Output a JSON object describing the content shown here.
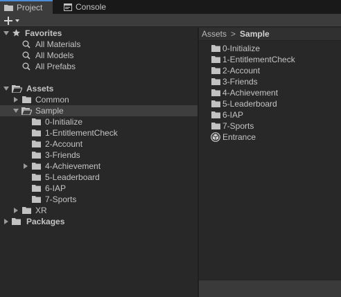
{
  "tabs": [
    {
      "label": "Project",
      "icon": "folder-icon",
      "active": true
    },
    {
      "label": "Console",
      "icon": "console-icon",
      "active": false
    }
  ],
  "toolbar": {
    "add_label": "+",
    "add_icon": "plus-dropdown-icon"
  },
  "tree": {
    "favorites": {
      "label": "Favorites",
      "items": [
        "All Materials",
        "All Models",
        "All Prefabs"
      ]
    },
    "assets": {
      "label": "Assets",
      "common": "Common",
      "sample": "Sample",
      "sample_children": [
        "0-Initialize",
        "1-EntitlementCheck",
        "2-Account",
        "3-Friends",
        "4-Achievement",
        "5-Leaderboard",
        "6-IAP",
        "7-Sports"
      ],
      "xr": "XR"
    },
    "packages": "Packages"
  },
  "breadcrumb": {
    "root": "Assets",
    "separator": ">",
    "current": "Sample"
  },
  "contents": [
    {
      "label": "0-Initialize",
      "icon": "folder-icon"
    },
    {
      "label": "1-EntitlementCheck",
      "icon": "folder-icon"
    },
    {
      "label": "2-Account",
      "icon": "folder-icon"
    },
    {
      "label": "3-Friends",
      "icon": "folder-icon"
    },
    {
      "label": "4-Achievement",
      "icon": "folder-icon"
    },
    {
      "label": "5-Leaderboard",
      "icon": "folder-icon"
    },
    {
      "label": "6-IAP",
      "icon": "folder-icon"
    },
    {
      "label": "7-Sports",
      "icon": "folder-icon"
    },
    {
      "label": "Entrance",
      "icon": "unity-scene-icon"
    }
  ],
  "colors": {
    "background": "#282828",
    "tab_accent": "#4d8cd6",
    "selection": "#3e3e3e",
    "folder": "#c2c2c2"
  }
}
